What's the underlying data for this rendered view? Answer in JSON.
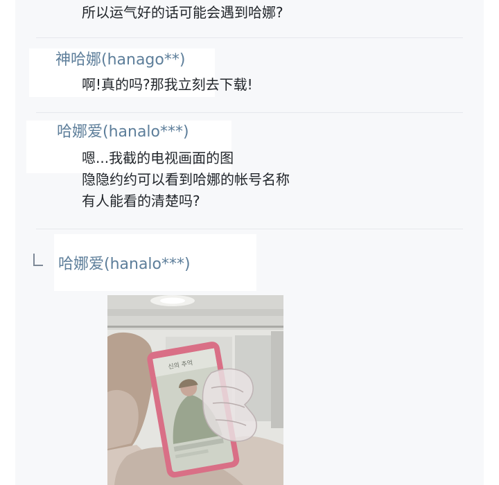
{
  "thread": {
    "top_message": {
      "text": "所以运气好的话可能会遇到哈娜?"
    },
    "post_1": {
      "username": "神哈娜(hanago**)",
      "lines": [
        "啊!真的吗?那我立刻去下载!"
      ]
    },
    "post_2": {
      "username": "哈娜爱(hanalo***)",
      "lines": [
        "嗯...我截的电视画面的图",
        "隐隐约约可以看到哈娜的帐号名称",
        "有人能看的清楚吗?"
      ]
    },
    "reply": {
      "icon": "reply-arrow-icon",
      "username": "哈娜爱(hanalo***)",
      "attachment": {
        "phone_screen_text": [
          "신의 추억"
        ]
      }
    }
  },
  "colors": {
    "page_background": "#ffffff",
    "board_background": "#f7f8fa",
    "username_text": "#5d7e9a",
    "body_text": "#22262b",
    "divider": "#e6e8ec",
    "phone_case": "#d96f86"
  }
}
